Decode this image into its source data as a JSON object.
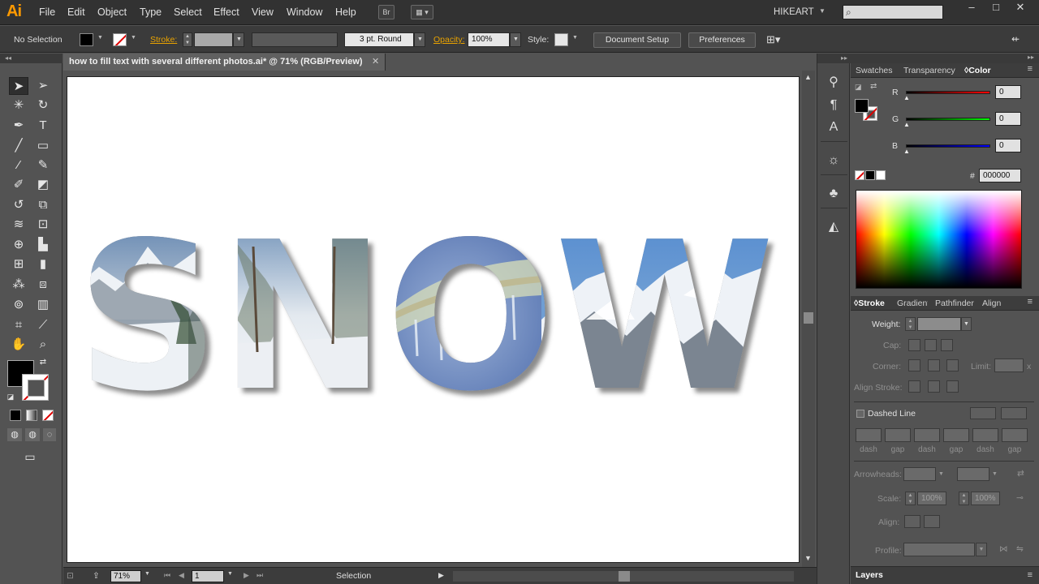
{
  "app": {
    "logo": "Ai",
    "menus": [
      "File",
      "Edit",
      "Object",
      "Type",
      "Select",
      "Effect",
      "View",
      "Window",
      "Help"
    ],
    "bridge_label": "Br",
    "user": "HIKEART",
    "window_controls": [
      "–",
      "□",
      "✕"
    ]
  },
  "control_bar": {
    "selection_status": "No Selection",
    "stroke_label": "Stroke:",
    "brush": "3 pt. Round",
    "opacity_label": "Opacity:",
    "opacity_value": "100%",
    "style_label": "Style:",
    "document_setup": "Document Setup",
    "preferences": "Preferences",
    "colors": {
      "fill": "#000000",
      "stroke": "none"
    }
  },
  "document": {
    "tab_title": "how to fill text with several different photos.ai* @ 71% (RGB/Preview)",
    "tab_close": "✕"
  },
  "artwork": {
    "text": "SNOW",
    "letters": [
      "S",
      "N",
      "O",
      "W"
    ]
  },
  "status_bar": {
    "zoom": "71%",
    "artboard": "1",
    "tool": "Selection"
  },
  "color_panel": {
    "tabs": [
      "Swatches",
      "Transparency",
      "Color"
    ],
    "active_tab": "Color",
    "channels": [
      {
        "name": "R",
        "value": "0"
      },
      {
        "name": "G",
        "value": "0"
      },
      {
        "name": "B",
        "value": "0"
      }
    ],
    "hex_label": "#",
    "hex_value": "000000"
  },
  "stroke_panel": {
    "tabs": [
      "Stroke",
      "Gradient",
      "Pathfinder",
      "Align"
    ],
    "active_tab": "Stroke",
    "weight_label": "Weight:",
    "cap_label": "Cap:",
    "corner_label": "Corner:",
    "limit_label": "Limit:",
    "limit_suffix": "x",
    "align_stroke_label": "Align Stroke:",
    "dashed_line_label": "Dashed Line",
    "dash_labels": [
      "dash",
      "gap",
      "dash",
      "gap",
      "dash",
      "gap"
    ],
    "arrowheads_label": "Arrowheads:",
    "scale_label": "Scale:",
    "scale_values": [
      "100%",
      "100%"
    ],
    "align_label": "Align:",
    "profile_label": "Profile:"
  },
  "layers_panel": {
    "title": "Layers"
  }
}
